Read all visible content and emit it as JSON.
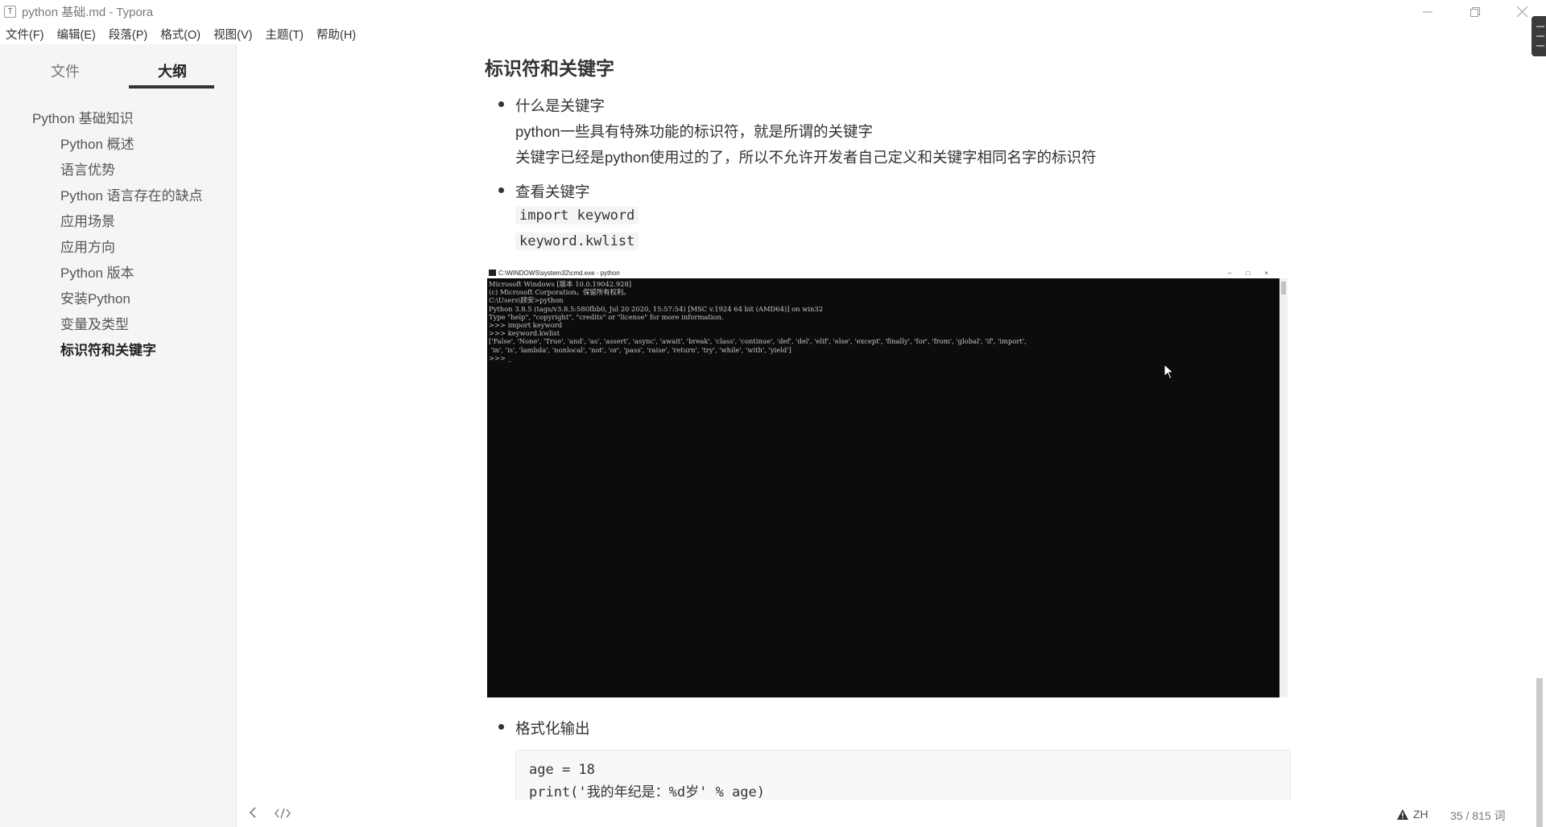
{
  "window": {
    "app_icon": "T",
    "title": "python 基础.md - Typora",
    "controls": [
      "minimize-icon",
      "restore-icon",
      "close-icon"
    ]
  },
  "menubar": [
    "文件(F)",
    "编辑(E)",
    "段落(P)",
    "格式(O)",
    "视图(V)",
    "主题(T)",
    "帮助(H)"
  ],
  "sidebar": {
    "tabs": {
      "files": "文件",
      "outline": "大纲",
      "active": "outline"
    },
    "outline": [
      {
        "label": "Python 基础知识",
        "level": 1
      },
      {
        "label": "Python 概述",
        "level": 2
      },
      {
        "label": "语言优势",
        "level": 2
      },
      {
        "label": "Python 语言存在的缺点",
        "level": 2
      },
      {
        "label": "应用场景",
        "level": 2
      },
      {
        "label": "应用方向",
        "level": 2
      },
      {
        "label": "Python 版本",
        "level": 2
      },
      {
        "label": "安装Python",
        "level": 2
      },
      {
        "label": "变量及类型",
        "level": 2
      },
      {
        "label": "标识符和关键字",
        "level": 2,
        "active": true
      }
    ]
  },
  "document": {
    "heading": "标识符和关键字",
    "item1": {
      "title": "什么是关键字",
      "line1": "python一些具有特殊功能的标识符，就是所谓的关键字",
      "line2": "关键字已经是python使用过的了，所以不允许开发者自己定义和关键字相同名字的标识符"
    },
    "item2": {
      "title": "查看关键字",
      "code1": "import keyword",
      "code2": "keyword.kwlist"
    },
    "cmd_screenshot": {
      "title": "C:\\WINDOWS\\system32\\cmd.exe - python",
      "lines": [
        "Microsoft Windows [版本 10.0.19042.928]",
        "(c) Microsoft Corporation。保留所有权利。",
        "",
        "C:\\Users\\顾安>python",
        "Python 3.8.5 (tags/v3.8.5:580fbb0, Jul 20 2020, 15:57:54) [MSC v.1924 64 bit (AMD64)] on win32",
        "Type \"help\", \"copyright\", \"credits\" or \"license\" for more information.",
        ">>> import keyword",
        ">>> keyword.kwlist",
        "['False', 'None', 'True', 'and', 'as', 'assert', 'async', 'await', 'break', 'class', 'continue', 'def', 'del', 'elif', 'else', 'except', 'finally', 'for', 'from', 'global', 'if', 'import',",
        " 'in', 'is', 'lambda', 'nonlocal', 'not', 'or', 'pass', 'raise', 'return', 'try', 'while', 'with', 'yield']",
        ">>> _"
      ]
    },
    "item3": {
      "title": "格式化输出",
      "code_lines": [
        "age = 18",
        "print('我的年纪是：%d岁' % age)"
      ]
    }
  },
  "statusbar": {
    "back_icon": "chevron-left-icon",
    "source_icon": "code-icon",
    "language": "ZH",
    "word_count": "35 / 815 词"
  }
}
